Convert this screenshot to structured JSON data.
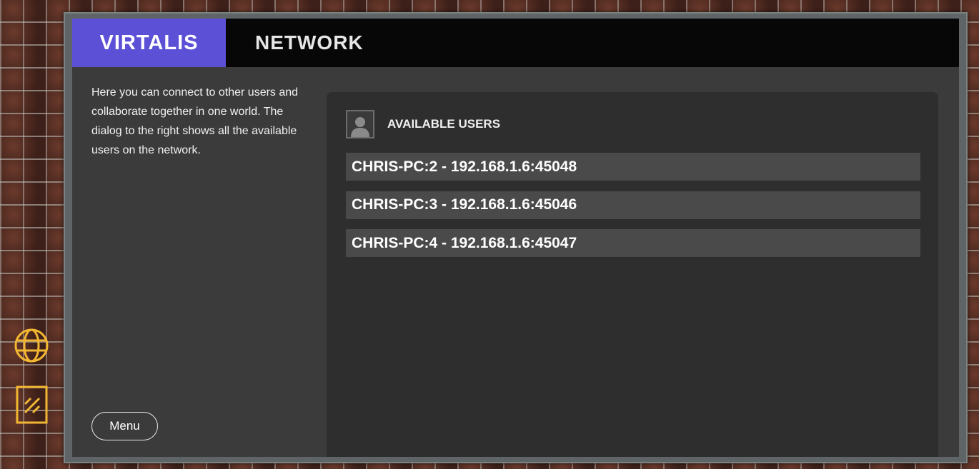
{
  "header": {
    "brand": "VIRTALIS",
    "title": "NETWORK"
  },
  "intro": {
    "text": "Here you can connect to other users and collaborate together in one world. The dialog to the right shows all the available users on the network."
  },
  "users": {
    "title": "AVAILABLE USERS",
    "list": [
      "CHRIS-PC:2 - 192.168.1.6:45048",
      "CHRIS-PC:3 - 192.168.1.6:45046",
      "CHRIS-PC:4 - 192.168.1.6:45047"
    ]
  },
  "footer": {
    "menu_label": "Menu"
  },
  "colors": {
    "brand": "#5b50d6",
    "rail_icon": "#f2b632",
    "panel": "#3b3b3b"
  },
  "icons": {
    "globe": "globe-icon",
    "tool": "tool-icon",
    "user": "user-icon"
  }
}
